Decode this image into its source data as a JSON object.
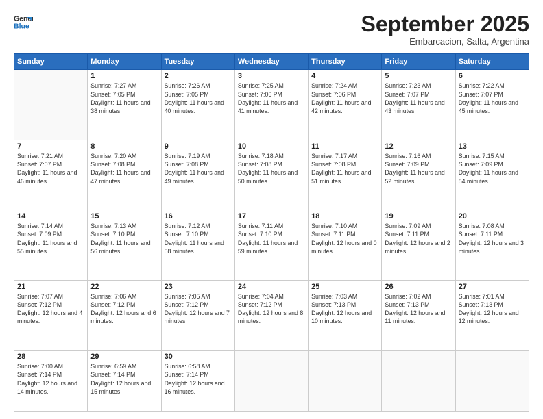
{
  "header": {
    "logo": {
      "line1": "General",
      "line2": "Blue"
    },
    "title": "September 2025",
    "location": "Embarcacion, Salta, Argentina"
  },
  "weekdays": [
    "Sunday",
    "Monday",
    "Tuesday",
    "Wednesday",
    "Thursday",
    "Friday",
    "Saturday"
  ],
  "weeks": [
    [
      {
        "day": "",
        "sunrise": "",
        "sunset": "",
        "daylight": ""
      },
      {
        "day": "1",
        "sunrise": "Sunrise: 7:27 AM",
        "sunset": "Sunset: 7:05 PM",
        "daylight": "Daylight: 11 hours and 38 minutes."
      },
      {
        "day": "2",
        "sunrise": "Sunrise: 7:26 AM",
        "sunset": "Sunset: 7:05 PM",
        "daylight": "Daylight: 11 hours and 40 minutes."
      },
      {
        "day": "3",
        "sunrise": "Sunrise: 7:25 AM",
        "sunset": "Sunset: 7:06 PM",
        "daylight": "Daylight: 11 hours and 41 minutes."
      },
      {
        "day": "4",
        "sunrise": "Sunrise: 7:24 AM",
        "sunset": "Sunset: 7:06 PM",
        "daylight": "Daylight: 11 hours and 42 minutes."
      },
      {
        "day": "5",
        "sunrise": "Sunrise: 7:23 AM",
        "sunset": "Sunset: 7:07 PM",
        "daylight": "Daylight: 11 hours and 43 minutes."
      },
      {
        "day": "6",
        "sunrise": "Sunrise: 7:22 AM",
        "sunset": "Sunset: 7:07 PM",
        "daylight": "Daylight: 11 hours and 45 minutes."
      }
    ],
    [
      {
        "day": "7",
        "sunrise": "Sunrise: 7:21 AM",
        "sunset": "Sunset: 7:07 PM",
        "daylight": "Daylight: 11 hours and 46 minutes."
      },
      {
        "day": "8",
        "sunrise": "Sunrise: 7:20 AM",
        "sunset": "Sunset: 7:08 PM",
        "daylight": "Daylight: 11 hours and 47 minutes."
      },
      {
        "day": "9",
        "sunrise": "Sunrise: 7:19 AM",
        "sunset": "Sunset: 7:08 PM",
        "daylight": "Daylight: 11 hours and 49 minutes."
      },
      {
        "day": "10",
        "sunrise": "Sunrise: 7:18 AM",
        "sunset": "Sunset: 7:08 PM",
        "daylight": "Daylight: 11 hours and 50 minutes."
      },
      {
        "day": "11",
        "sunrise": "Sunrise: 7:17 AM",
        "sunset": "Sunset: 7:08 PM",
        "daylight": "Daylight: 11 hours and 51 minutes."
      },
      {
        "day": "12",
        "sunrise": "Sunrise: 7:16 AM",
        "sunset": "Sunset: 7:09 PM",
        "daylight": "Daylight: 11 hours and 52 minutes."
      },
      {
        "day": "13",
        "sunrise": "Sunrise: 7:15 AM",
        "sunset": "Sunset: 7:09 PM",
        "daylight": "Daylight: 11 hours and 54 minutes."
      }
    ],
    [
      {
        "day": "14",
        "sunrise": "Sunrise: 7:14 AM",
        "sunset": "Sunset: 7:09 PM",
        "daylight": "Daylight: 11 hours and 55 minutes."
      },
      {
        "day": "15",
        "sunrise": "Sunrise: 7:13 AM",
        "sunset": "Sunset: 7:10 PM",
        "daylight": "Daylight: 11 hours and 56 minutes."
      },
      {
        "day": "16",
        "sunrise": "Sunrise: 7:12 AM",
        "sunset": "Sunset: 7:10 PM",
        "daylight": "Daylight: 11 hours and 58 minutes."
      },
      {
        "day": "17",
        "sunrise": "Sunrise: 7:11 AM",
        "sunset": "Sunset: 7:10 PM",
        "daylight": "Daylight: 11 hours and 59 minutes."
      },
      {
        "day": "18",
        "sunrise": "Sunrise: 7:10 AM",
        "sunset": "Sunset: 7:11 PM",
        "daylight": "Daylight: 12 hours and 0 minutes."
      },
      {
        "day": "19",
        "sunrise": "Sunrise: 7:09 AM",
        "sunset": "Sunset: 7:11 PM",
        "daylight": "Daylight: 12 hours and 2 minutes."
      },
      {
        "day": "20",
        "sunrise": "Sunrise: 7:08 AM",
        "sunset": "Sunset: 7:11 PM",
        "daylight": "Daylight: 12 hours and 3 minutes."
      }
    ],
    [
      {
        "day": "21",
        "sunrise": "Sunrise: 7:07 AM",
        "sunset": "Sunset: 7:12 PM",
        "daylight": "Daylight: 12 hours and 4 minutes."
      },
      {
        "day": "22",
        "sunrise": "Sunrise: 7:06 AM",
        "sunset": "Sunset: 7:12 PM",
        "daylight": "Daylight: 12 hours and 6 minutes."
      },
      {
        "day": "23",
        "sunrise": "Sunrise: 7:05 AM",
        "sunset": "Sunset: 7:12 PM",
        "daylight": "Daylight: 12 hours and 7 minutes."
      },
      {
        "day": "24",
        "sunrise": "Sunrise: 7:04 AM",
        "sunset": "Sunset: 7:12 PM",
        "daylight": "Daylight: 12 hours and 8 minutes."
      },
      {
        "day": "25",
        "sunrise": "Sunrise: 7:03 AM",
        "sunset": "Sunset: 7:13 PM",
        "daylight": "Daylight: 12 hours and 10 minutes."
      },
      {
        "day": "26",
        "sunrise": "Sunrise: 7:02 AM",
        "sunset": "Sunset: 7:13 PM",
        "daylight": "Daylight: 12 hours and 11 minutes."
      },
      {
        "day": "27",
        "sunrise": "Sunrise: 7:01 AM",
        "sunset": "Sunset: 7:13 PM",
        "daylight": "Daylight: 12 hours and 12 minutes."
      }
    ],
    [
      {
        "day": "28",
        "sunrise": "Sunrise: 7:00 AM",
        "sunset": "Sunset: 7:14 PM",
        "daylight": "Daylight: 12 hours and 14 minutes."
      },
      {
        "day": "29",
        "sunrise": "Sunrise: 6:59 AM",
        "sunset": "Sunset: 7:14 PM",
        "daylight": "Daylight: 12 hours and 15 minutes."
      },
      {
        "day": "30",
        "sunrise": "Sunrise: 6:58 AM",
        "sunset": "Sunset: 7:14 PM",
        "daylight": "Daylight: 12 hours and 16 minutes."
      },
      {
        "day": "",
        "sunrise": "",
        "sunset": "",
        "daylight": ""
      },
      {
        "day": "",
        "sunrise": "",
        "sunset": "",
        "daylight": ""
      },
      {
        "day": "",
        "sunrise": "",
        "sunset": "",
        "daylight": ""
      },
      {
        "day": "",
        "sunrise": "",
        "sunset": "",
        "daylight": ""
      }
    ]
  ]
}
